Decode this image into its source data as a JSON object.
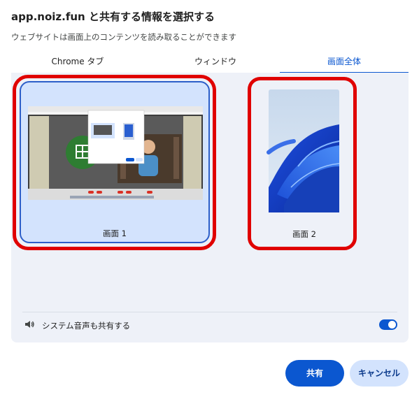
{
  "dialog": {
    "title": "app.noiz.fun と共有する情報を選択する",
    "subtitle": "ウェブサイトは画面上のコンテンツを読み取ることができます"
  },
  "tabs": [
    {
      "label": "Chrome タブ",
      "selected": false
    },
    {
      "label": "ウィンドウ",
      "selected": false
    },
    {
      "label": "画面全体",
      "selected": true
    }
  ],
  "screens": [
    {
      "label": "画面 1",
      "selected": true,
      "preview": "desktop-screenshot"
    },
    {
      "label": "画面 2",
      "selected": false,
      "preview": "windows-bloom-wallpaper"
    }
  ],
  "audio": {
    "label": "システム音声も共有する",
    "enabled": true,
    "icon": "speaker-icon"
  },
  "buttons": {
    "share": "共有",
    "cancel": "キャンセル"
  },
  "colors": {
    "accent": "#0b57d0",
    "selected_card_bg": "#d3e3fd",
    "panel_bg": "#eef1f8",
    "highlight": "#e00000"
  }
}
